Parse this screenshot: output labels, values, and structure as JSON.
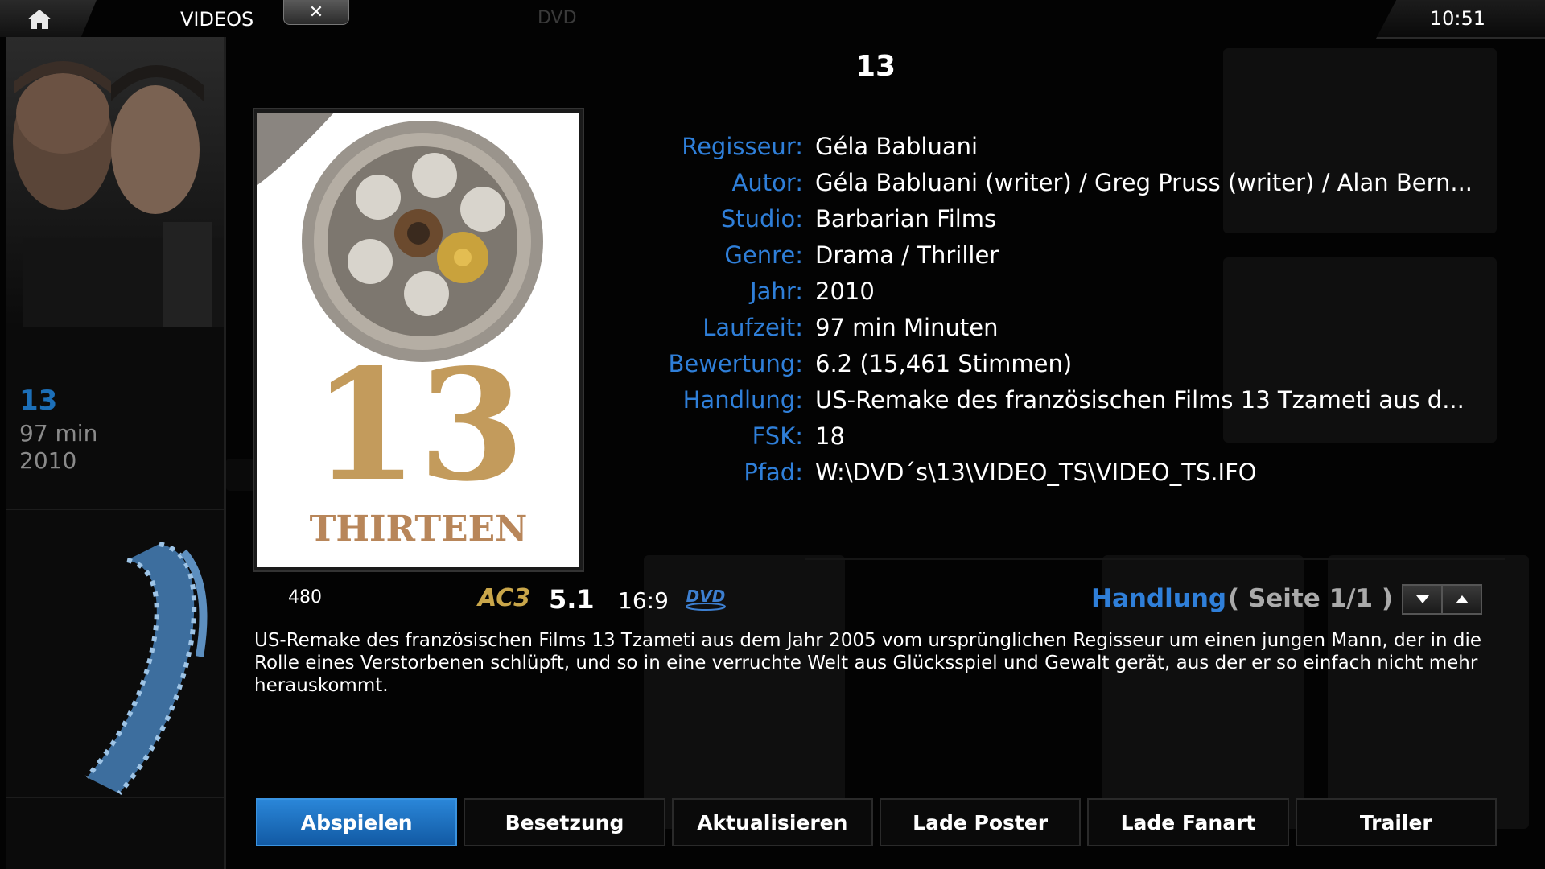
{
  "header": {
    "breadcrumb_section": "VIDEOS",
    "breadcrumb_sub": "DVD",
    "clock": "10:51",
    "close_symbol": "✕"
  },
  "sidebar": {
    "title": "13",
    "runtime": "97 min",
    "year": "2010"
  },
  "movie": {
    "title": "13",
    "details": [
      {
        "label": "Regisseur:",
        "value": "Géla Babluani"
      },
      {
        "label": "Autor:",
        "value": "Géla Babluani (writer) / Greg Pruss (writer) / Alan Bern..."
      },
      {
        "label": "Studio:",
        "value": "Barbarian Films"
      },
      {
        "label": "Genre:",
        "value": "Drama / Thriller"
      },
      {
        "label": "Jahr:",
        "value": "2010"
      },
      {
        "label": "Laufzeit:",
        "value": "97 min Minuten"
      },
      {
        "label": "Bewertung:",
        "value": "6.2 (15,461 Stimmen)"
      },
      {
        "label": "Handlung:",
        "value": "US-Remake des französischen Films 13 Tzameti aus d..."
      },
      {
        "label": "FSK:",
        "value": "18"
      },
      {
        "label": "Pfad:",
        "value": "W:\\DVD´s\\13\\VIDEO_TS\\VIDEO_TS.IFO"
      }
    ]
  },
  "poster": {
    "big_number": "13",
    "word": "THIRTEEN"
  },
  "flags": {
    "resolution": "480",
    "audio_codec": "AC3",
    "channels": "5.1",
    "aspect": "16:9",
    "source": "DVD"
  },
  "plot": {
    "heading": "Handlung",
    "page_info": "( Seite 1/1 )",
    "text": "US-Remake des französischen Films 13 Tzameti aus dem Jahr 2005 vom ursprünglichen Regisseur um einen jungen Mann, der in die Rolle eines Verstorbenen schlüpft, und so in eine verruchte Welt aus Glücksspiel und Gewalt gerät, aus der er so einfach nicht mehr herauskommt."
  },
  "buttons": {
    "play": "Abspielen",
    "cast": "Besetzung",
    "refresh": "Aktualisieren",
    "get_thumb": "Lade Poster",
    "get_fanart": "Lade Fanart",
    "trailer": "Trailer"
  },
  "colors": {
    "accent_blue": "#2f7fd9",
    "focus_blue": "#1c6fb8",
    "ac3_gold": "#c9a64a",
    "background": "#030303"
  },
  "icons": {
    "home": "home-icon",
    "close": "close-icon",
    "scroll_down": "arrow-down-icon",
    "scroll_up": "arrow-up-icon",
    "dvd": "dvd-logo-icon"
  }
}
